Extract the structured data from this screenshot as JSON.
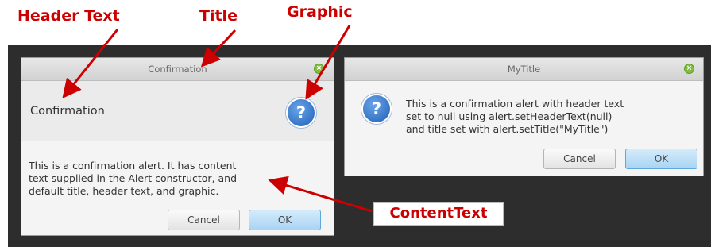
{
  "annotations": {
    "header_text": "Header Text",
    "title": "Title",
    "graphic": "Graphic",
    "content_text": "ContentText"
  },
  "dialog1": {
    "window_title": "Confirmation",
    "header_text": "Confirmation",
    "graphic_icon": "question-icon",
    "graphic_glyph": "?",
    "content_lines": [
      "This is a confirmation alert.  It has content",
      "text supplied in the Alert constructor, and",
      "default title, header text, and graphic."
    ],
    "cancel_label": "Cancel",
    "ok_label": "OK"
  },
  "dialog2": {
    "window_title": "MyTitle",
    "graphic_icon": "question-icon",
    "graphic_glyph": "?",
    "content_lines": [
      "This is a confirmation alert with header text",
      "set to null using alert.setHeaderText(null)",
      "and title set with alert.setTitle(\"MyTitle\")"
    ],
    "cancel_label": "Cancel",
    "ok_label": "OK"
  },
  "colors": {
    "annotation_red": "#cc0000",
    "ok_button_blue": "#a9d4f3",
    "window_close_green": "#7fbf3b",
    "icon_blue": "#1f5fb7"
  }
}
